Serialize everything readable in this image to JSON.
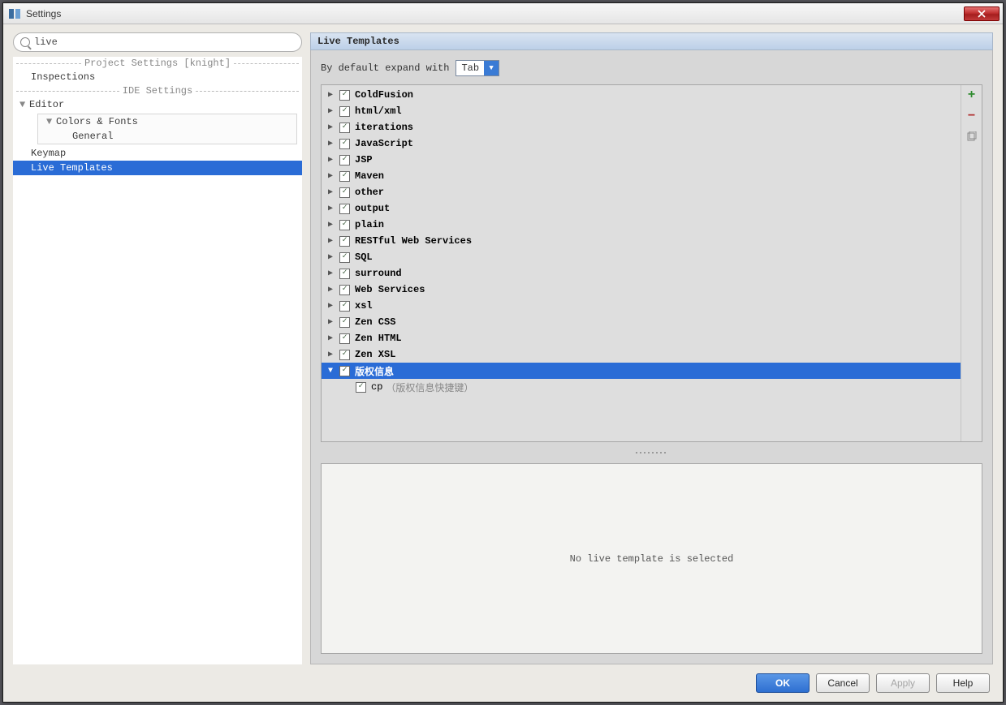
{
  "window": {
    "title": "Settings"
  },
  "search": {
    "value": "live"
  },
  "sidebar": {
    "section_project": "Project Settings [knight]",
    "section_ide": "IDE Settings",
    "inspections": "Inspections",
    "editor": "Editor",
    "colors_fonts": "Colors & Fonts",
    "general": "General",
    "keymap": "Keymap",
    "live_templates": "Live Templates"
  },
  "panel": {
    "title": "Live Templates",
    "expand_label": "By default expand with",
    "expand_value": "Tab"
  },
  "templates": [
    {
      "label": "ColdFusion",
      "checked": true,
      "expanded": false
    },
    {
      "label": "html/xml",
      "checked": true,
      "expanded": false
    },
    {
      "label": "iterations",
      "checked": true,
      "expanded": false
    },
    {
      "label": "JavaScript",
      "checked": true,
      "expanded": false
    },
    {
      "label": "JSP",
      "checked": true,
      "expanded": false
    },
    {
      "label": "Maven",
      "checked": true,
      "expanded": false
    },
    {
      "label": "other",
      "checked": true,
      "expanded": false
    },
    {
      "label": "output",
      "checked": true,
      "expanded": false
    },
    {
      "label": "plain",
      "checked": true,
      "expanded": false
    },
    {
      "label": "RESTful Web Services",
      "checked": true,
      "expanded": false
    },
    {
      "label": "SQL",
      "checked": true,
      "expanded": false
    },
    {
      "label": "surround",
      "checked": true,
      "expanded": false
    },
    {
      "label": "Web Services",
      "checked": true,
      "expanded": false
    },
    {
      "label": "xsl",
      "checked": true,
      "expanded": false
    },
    {
      "label": "Zen CSS",
      "checked": true,
      "expanded": false
    },
    {
      "label": "Zen HTML",
      "checked": true,
      "expanded": false
    },
    {
      "label": "Zen XSL",
      "checked": true,
      "expanded": false
    },
    {
      "label": "版权信息",
      "checked": true,
      "expanded": true,
      "selected": true,
      "children": [
        {
          "label": "cp",
          "hint": "（版权信息快捷键）",
          "checked": true
        }
      ]
    }
  ],
  "detail": {
    "empty_text": "No live template is selected"
  },
  "buttons": {
    "ok": "OK",
    "cancel": "Cancel",
    "apply": "Apply",
    "help": "Help"
  }
}
